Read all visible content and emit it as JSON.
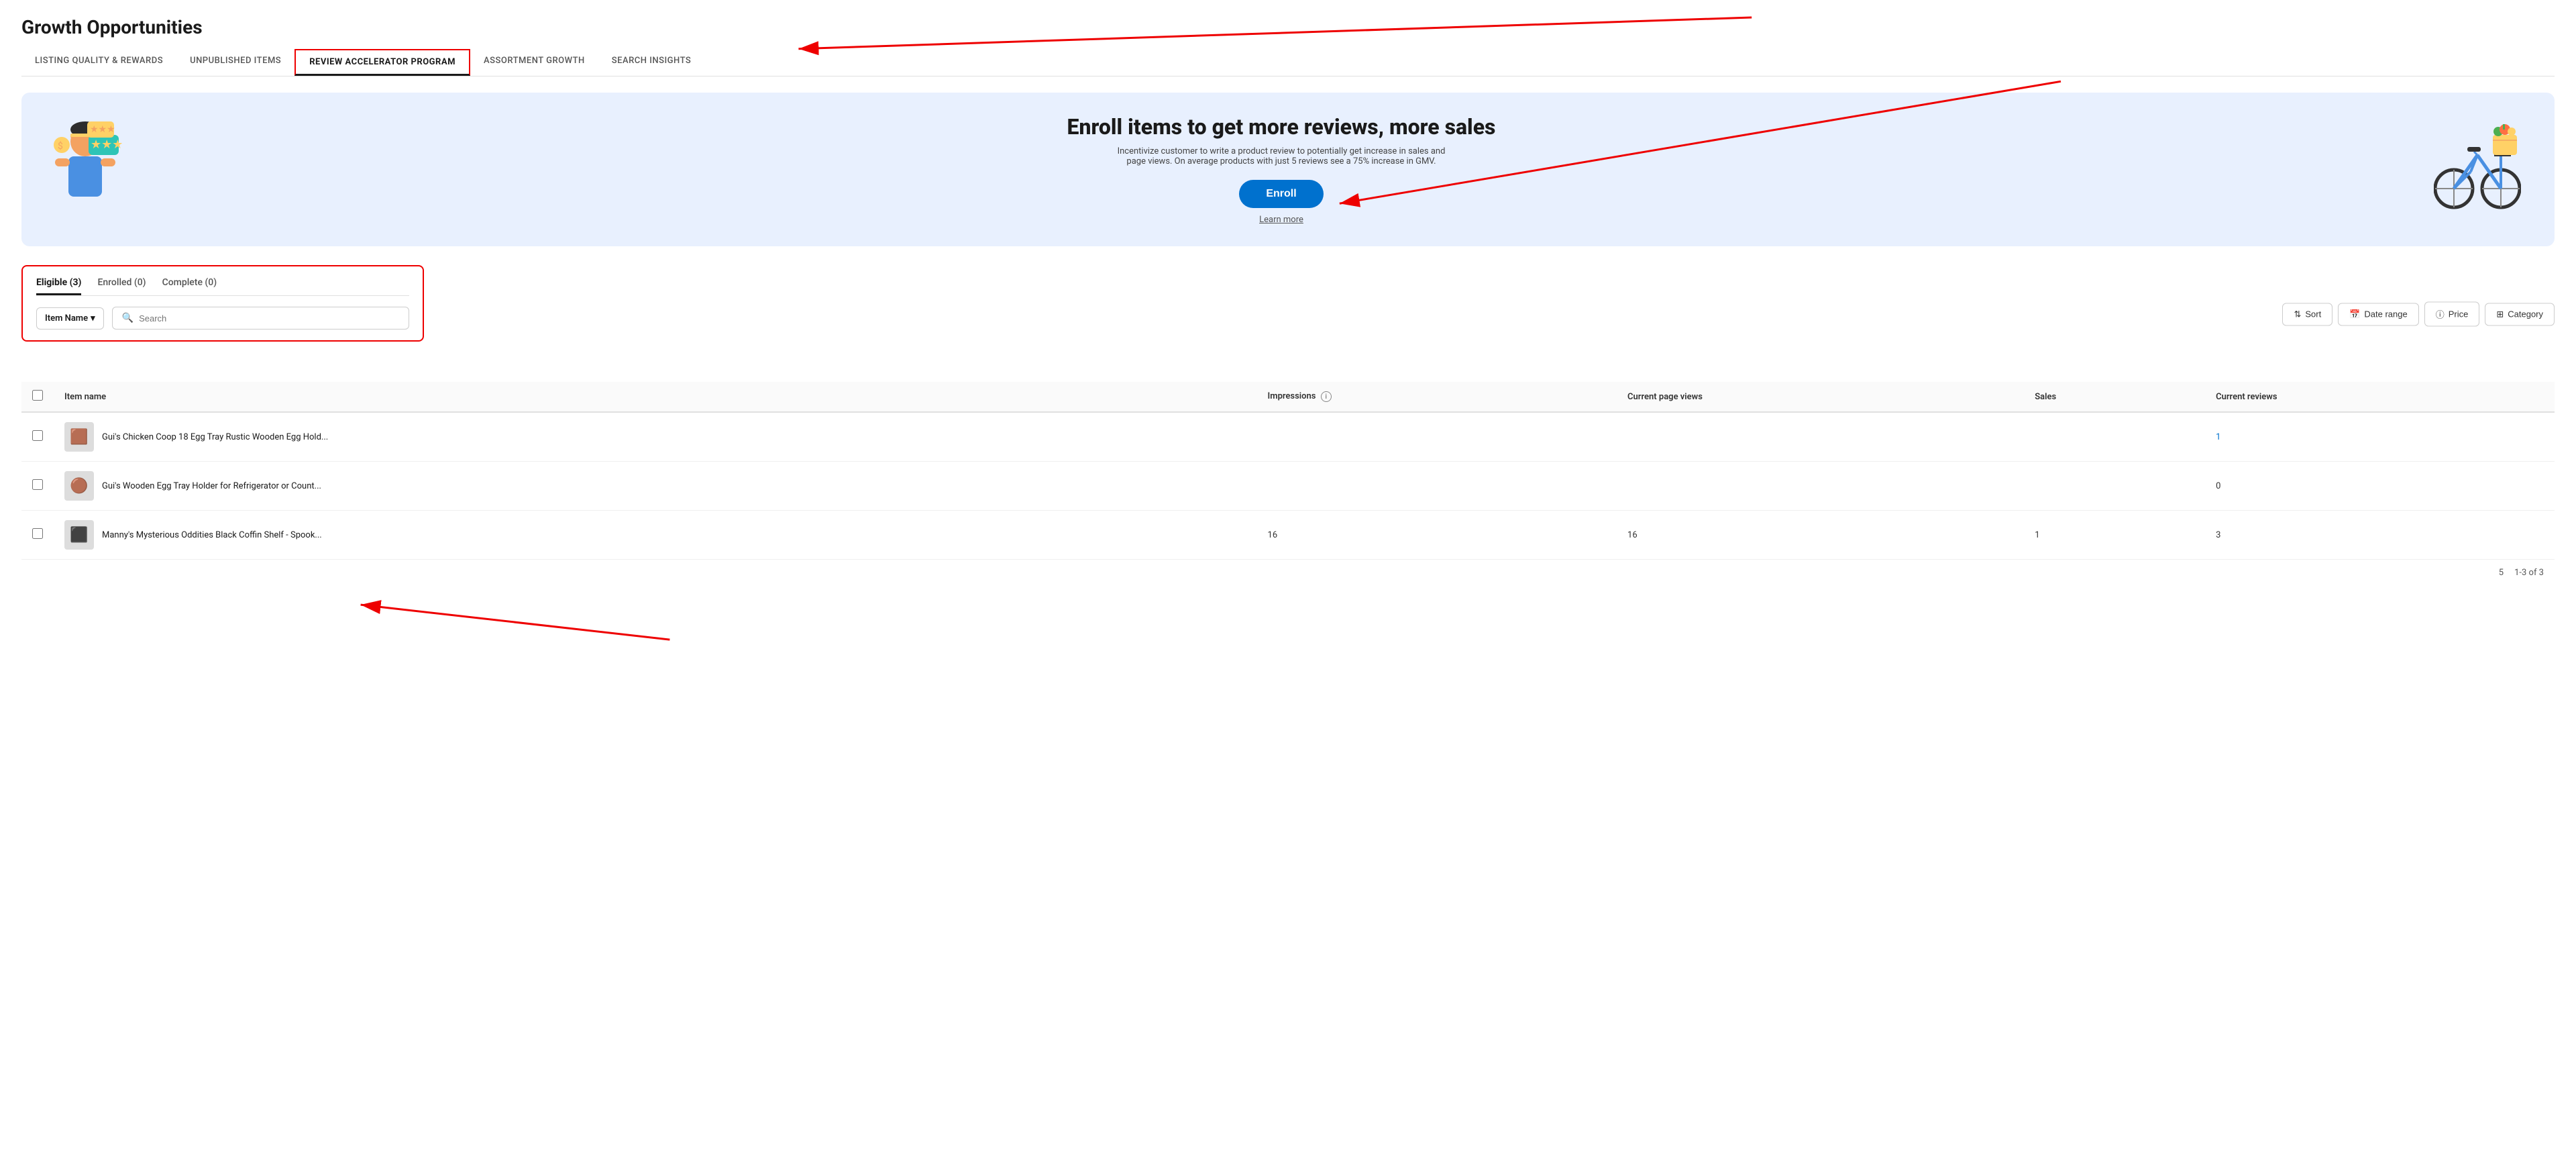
{
  "page": {
    "title": "Growth Opportunities"
  },
  "tabs": [
    {
      "id": "listing-quality",
      "label": "LISTING QUALITY & REWARDS",
      "active": false
    },
    {
      "id": "unpublished-items",
      "label": "UNPUBLISHED ITEMS",
      "active": false
    },
    {
      "id": "review-accelerator",
      "label": "REVIEW ACCELERATOR PROGRAM",
      "active": true,
      "highlighted": true
    },
    {
      "id": "assortment-growth",
      "label": "ASSORTMENT GROWTH",
      "active": false
    },
    {
      "id": "search-insights",
      "label": "SEARCH INSIGHTS",
      "active": false
    }
  ],
  "banner": {
    "title": "Enroll items to get more reviews, more sales",
    "description": "Incentivize customer to write a product review to potentially get increase in sales and page views. On average products with just 5 reviews see a 75% increase in GMV.",
    "enroll_label": "Enroll",
    "learn_more_label": "Learn more"
  },
  "filter_tabs": [
    {
      "id": "eligible",
      "label": "Eligible (3)",
      "active": true
    },
    {
      "id": "enrolled",
      "label": "Enrolled (0)",
      "active": false
    },
    {
      "id": "complete",
      "label": "Complete (0)",
      "active": false
    }
  ],
  "search": {
    "dropdown_label": "Item Name",
    "placeholder": "Search"
  },
  "toolbar": {
    "sort_label": "Sort",
    "date_range_label": "Date range",
    "price_label": "Price",
    "category_label": "Category"
  },
  "table": {
    "columns": [
      {
        "id": "item-name",
        "label": "Item name"
      },
      {
        "id": "impressions",
        "label": "Impressions",
        "has_info": true
      },
      {
        "id": "page-views",
        "label": "Current page views"
      },
      {
        "id": "sales",
        "label": "Sales"
      },
      {
        "id": "reviews",
        "label": "Current reviews"
      }
    ],
    "rows": [
      {
        "id": 1,
        "name": "Gui's Chicken Coop 18 Egg Tray Rustic Wooden Egg Hold...",
        "impressions": "",
        "page_views": "",
        "sales": "",
        "reviews": "1",
        "review_is_link": true,
        "emoji": "🟫"
      },
      {
        "id": 2,
        "name": "Gui's Wooden Egg Tray Holder for Refrigerator or Count...",
        "impressions": "",
        "page_views": "",
        "sales": "",
        "reviews": "0",
        "review_is_link": false,
        "emoji": "🟤"
      },
      {
        "id": 3,
        "name": "Manny's Mysterious Oddities Black Coffin Shelf - Spook...",
        "impressions": "16",
        "page_views": "16",
        "sales": "1",
        "reviews": "3",
        "review_is_link": false,
        "emoji": "⬛"
      }
    ]
  },
  "pagination": {
    "per_page_label": "5",
    "page_info": "1-3 of 3"
  }
}
